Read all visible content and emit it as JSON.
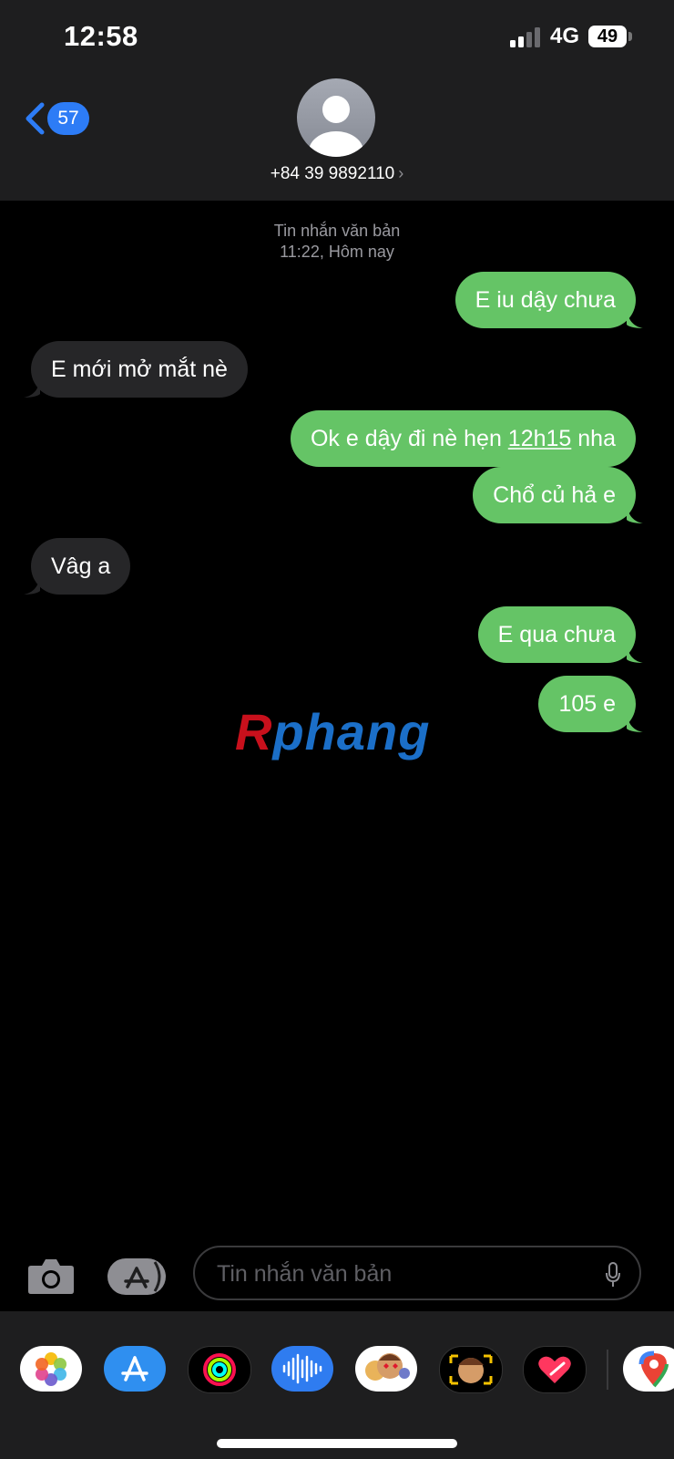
{
  "status_bar": {
    "time": "12:58",
    "network": "4G",
    "battery": "49"
  },
  "header": {
    "back_count": "57",
    "contact": "+84 39 9892110",
    "chevron": "›"
  },
  "thread": {
    "label": "Tin nhắn văn bản",
    "time": "11:22, Hôm nay",
    "messages": [
      {
        "side": "sent",
        "text": "E iu dậy chưa"
      },
      {
        "side": "received",
        "text": "E mới mở mắt nè"
      },
      {
        "side": "sent",
        "text_before": "Ok e dậy đi nè hẹn ",
        "link": "12h15",
        "text_after": " nha"
      },
      {
        "side": "sent",
        "text": "Chổ củ hả e"
      },
      {
        "side": "received",
        "text": "Vâg a"
      },
      {
        "side": "sent",
        "text": "E qua chưa"
      },
      {
        "side": "sent",
        "text": "105 e"
      }
    ]
  },
  "watermark": {
    "first": "R",
    "rest": "phang"
  },
  "composer": {
    "placeholder": "Tin nhắn văn bản"
  },
  "colors": {
    "sent": "#65c466",
    "received": "#262628",
    "accent": "#2d7cf6"
  },
  "app_tray": [
    "photos-icon",
    "app-store-icon",
    "activity-icon",
    "audio-icon",
    "memoji-icon",
    "memoji-sticker-icon",
    "digital-touch-icon",
    "maps-icon"
  ]
}
